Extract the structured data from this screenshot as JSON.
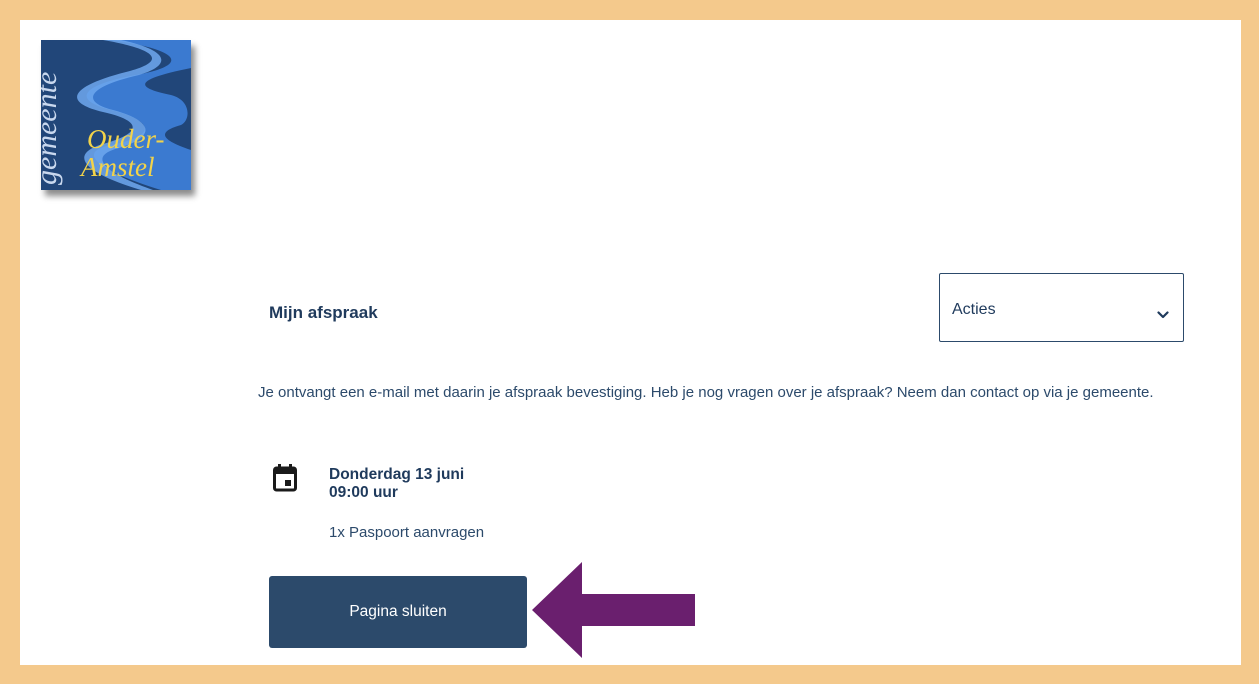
{
  "logo": {
    "line1": "gemeente",
    "line2": "Ouder-",
    "line3": "Amstel",
    "colors": {
      "background": "#1e4478",
      "river": "#3a7bd5",
      "text": "#f2d34a"
    }
  },
  "appointment": {
    "heading": "Mijn afspraak",
    "actions_select": {
      "selected": "Acties"
    },
    "info_text": "Je ontvangt een e-mail met daarin je afspraak bevestiging. Heb je nog vragen over je afspraak? Neem dan contact op via je gemeente.",
    "date": "Donderdag 13 juni",
    "time": "09:00 uur",
    "service": "1x Paspoort aanvragen",
    "close_button_label": "Pagina sluiten",
    "calendar_icon": "calendar-icon"
  },
  "annotation": {
    "arrow_color": "#6a1f6e"
  },
  "colors": {
    "frame": "#f4c98c",
    "primary": "#2c4a6b",
    "text": "#1f3a5c"
  }
}
